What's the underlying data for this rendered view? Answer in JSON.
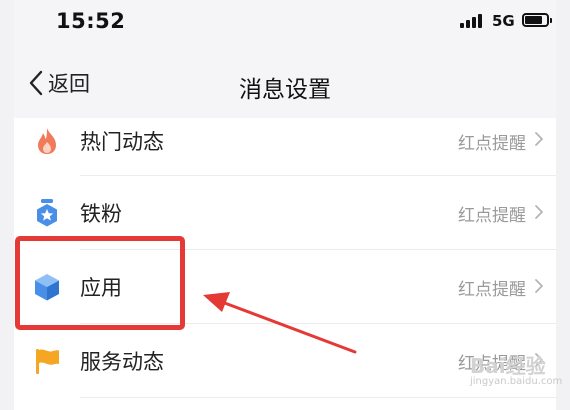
{
  "status_bar": {
    "time": "15:52",
    "network": "5G",
    "icons": [
      "signal-icon",
      "battery-icon"
    ]
  },
  "nav": {
    "back_label": "返回",
    "title": "消息设置"
  },
  "rows": [
    {
      "label": "热门动态",
      "value": "红点提醒",
      "icon": "fire-icon"
    },
    {
      "label": "铁粉",
      "value": "红点提醒",
      "icon": "fan-badge-icon"
    },
    {
      "label": "应用",
      "value": "红点提醒",
      "icon": "app-cube-icon"
    },
    {
      "label": "服务动态",
      "value": "红点提醒",
      "icon": "flag-icon"
    }
  ],
  "annotation": {
    "highlight_color": "#e53935",
    "highlighted_row": "应用"
  },
  "watermark": {
    "mark": "Bai经验",
    "url": "jingyan.baidu.com"
  },
  "colors": {
    "accent_blue": "#4a8fe7",
    "fire_orange": "#f07a5a",
    "flag_orange": "#f5a623",
    "secondary_text": "#9a9a9a"
  }
}
